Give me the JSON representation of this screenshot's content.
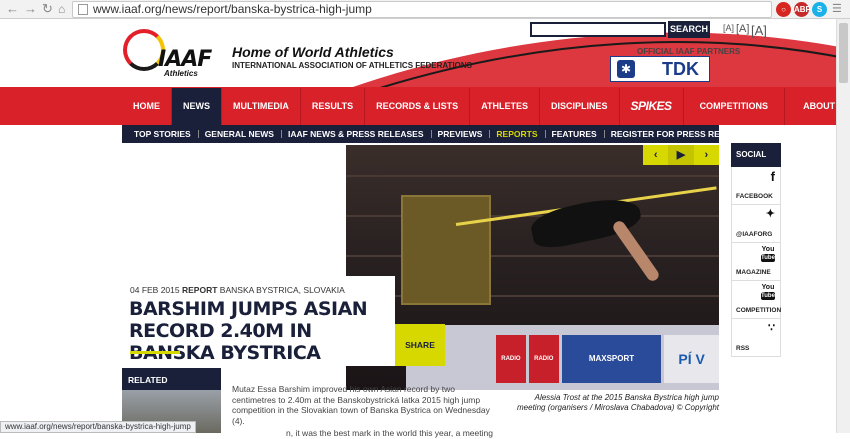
{
  "browser": {
    "url": "www.iaaf.org/news/report/banska-bystrica-high-jump",
    "back_icon": "arrow-left",
    "forward_icon": "arrow-right",
    "reload_icon": "reload",
    "home_icon": "home",
    "status_url": "www.iaaf.org/news/report/banska-bystrica-high-jump"
  },
  "header": {
    "logo_text": "IAAF",
    "logo_sub": "Athletics",
    "tagline": "Home of World Athletics",
    "org_name": "INTERNATIONAL ASSOCIATION OF ATHLETICS FEDERATIONS",
    "search_label": "SEARCH",
    "search_placeholder": "",
    "text_sizes": [
      "[A]",
      "[A]",
      "[A]"
    ],
    "partners_label": "OFFICIAL IAAF PARTNERS",
    "partner_name": "TDK"
  },
  "main_nav": [
    {
      "label": "HOME",
      "active": false
    },
    {
      "label": "NEWS",
      "active": true
    },
    {
      "label": "MULTIMEDIA",
      "active": false
    },
    {
      "label": "RESULTS",
      "active": false
    },
    {
      "label": "RECORDS & LISTS",
      "active": false
    },
    {
      "label": "ATHLETES",
      "active": false
    },
    {
      "label": "DISCIPLINES",
      "active": false
    },
    {
      "label": "SPIKES",
      "active": false
    },
    {
      "label": "COMPETITIONS",
      "active": false
    },
    {
      "label": "ABOUT IAAF",
      "active": false
    }
  ],
  "sub_nav": [
    {
      "label": "TOP STORIES",
      "active": false
    },
    {
      "label": "GENERAL NEWS",
      "active": false
    },
    {
      "label": "IAAF NEWS & PRESS RELEASES",
      "active": false
    },
    {
      "label": "PREVIEWS",
      "active": false
    },
    {
      "label": "REPORTS",
      "active": true
    },
    {
      "label": "FEATURES",
      "active": false
    },
    {
      "label": "REGISTER FOR PRESS RELEASES",
      "active": false
    }
  ],
  "hero": {
    "gallery_controls": [
      "‹",
      "▶",
      "›"
    ],
    "ads": [
      "RADIO ONE RETRO",
      "RADIO ONE ROCK",
      "MAXSPORT",
      "PÍ V"
    ],
    "caption": "Alessia Trost at the 2015 Banska Bystrica high jump meeting (organisers / Miroslava Chabadova) © Copyright"
  },
  "article": {
    "date": "04 FEB 2015",
    "type": "REPORT",
    "location": "BANSKA BYSTRICA, SLOVAKIA",
    "headline": "BARSHIM JUMPS ASIAN RECORD 2.40M IN BANSKA BYSTRICA",
    "share_label": "SHARE",
    "body": "Mutaz Essa Barshim improved his own Asian record by two centimetres to 2.40m at the Banskobystrická latka 2015 high jump competition in the Slovakian town of Banska Bystrica on Wednesday (4).",
    "body_cont": "n, it was the best mark in the world this year, a meeting"
  },
  "related": {
    "label": "RELATED"
  },
  "social": {
    "heading": "SOCIAL",
    "items": [
      {
        "label": "FACEBOOK",
        "icon": "facebook-icon",
        "glyph": "f"
      },
      {
        "label": "@IAAFORG",
        "icon": "twitter-icon",
        "glyph": "🐦"
      },
      {
        "label": "MAGAZINE",
        "icon": "youtube-icon",
        "glyph": "You"
      },
      {
        "label": "COMPETITION",
        "icon": "youtube-icon",
        "glyph": "You"
      },
      {
        "label": "RSS",
        "icon": "rss-icon",
        "glyph": "◉"
      }
    ]
  },
  "colors": {
    "brand_red": "#d9212a",
    "navy": "#1a1f3a",
    "accent_yellow": "#d6d800"
  }
}
